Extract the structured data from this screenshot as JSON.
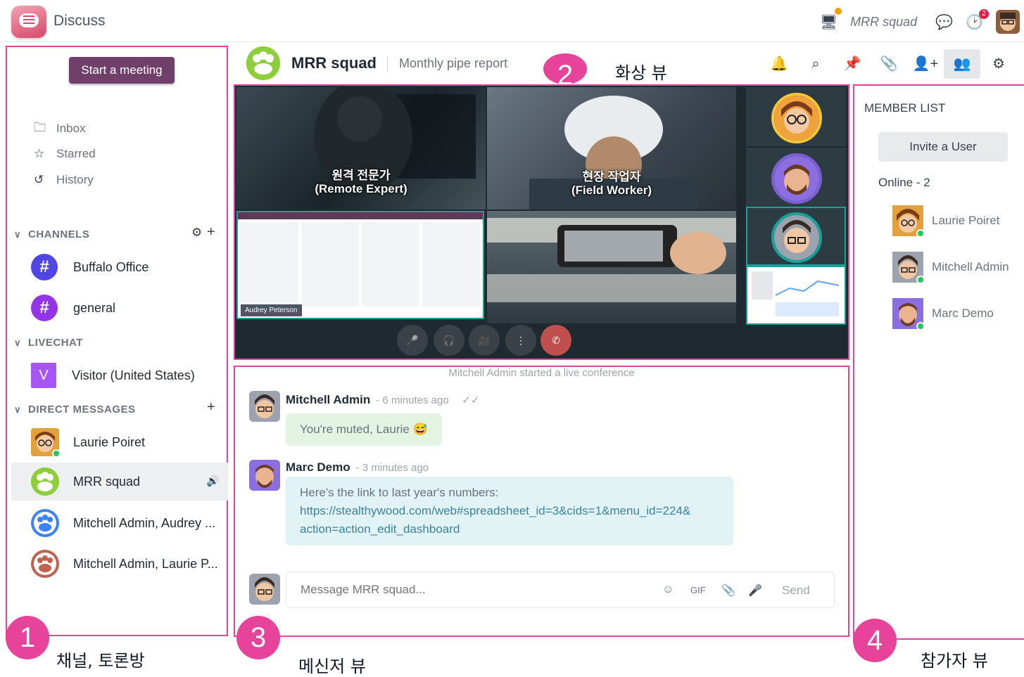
{
  "app": {
    "name": "Discuss"
  },
  "topbar": {
    "current_channel": "MRR squad",
    "activity_badge": "2"
  },
  "sidebar": {
    "start_meeting": "Start a meeting",
    "nav": [
      {
        "label": "Inbox",
        "icon": "inbox-icon"
      },
      {
        "label": "Starred",
        "icon": "star-icon"
      },
      {
        "label": "History",
        "icon": "history-icon"
      }
    ],
    "sections": {
      "channels": "CHANNELS",
      "livechat": "LIVECHAT",
      "direct_messages": "DIRECT MESSAGES"
    },
    "channels": [
      {
        "label": "Buffalo Office",
        "color": "#4f46e5"
      },
      {
        "label": "general",
        "color": "#9333ea"
      }
    ],
    "livechat": [
      {
        "label": "Visitor (United States)",
        "initial": "V"
      }
    ],
    "direct_messages": [
      {
        "label": "Laurie Poiret"
      },
      {
        "label": "MRR squad",
        "active": true
      },
      {
        "label": "Mitchell Admin, Audrey ..."
      },
      {
        "label": "Mitchell Admin, Laurie P..."
      }
    ]
  },
  "thread": {
    "title": "MRR squad",
    "description": "Monthly pipe report"
  },
  "video": {
    "tile1_text": "원격 전문가\n(Remote Expert)",
    "tile2_text": "현장 작업자\n(Field Worker)",
    "screen_share_name": "Audrey Peterson"
  },
  "messages": {
    "conference_note": "Mitchell Admin started a live conference",
    "items": [
      {
        "author": "Mitchell Admin",
        "time": "- 6 minutes ago",
        "body": "You're muted, Laurie 😅"
      },
      {
        "author": "Marc Demo",
        "time": "- 3 minutes ago",
        "body_line1": "Here's the link to last year's numbers:",
        "link": "https://stealthywood.com/web#spreadsheet_id=3&cids=1&menu_id=224&",
        "link2": "action=action_edit_dashboard"
      }
    ],
    "composer_placeholder": "Message MRR squad...",
    "gif_label": "GIF",
    "send_label": "Send"
  },
  "members": {
    "title": "MEMBER LIST",
    "invite": "Invite a User",
    "online_label": "Online - 2",
    "list": [
      {
        "name": "Laurie Poiret"
      },
      {
        "name": "Mitchell Admin"
      },
      {
        "name": "Marc Demo"
      }
    ]
  },
  "annotations": {
    "one": "1",
    "two": "2",
    "three": "3",
    "four": "4",
    "caption1": "채널, 토론방",
    "caption2": "화상 뷰",
    "caption3": "메신저 뷰",
    "caption4": "참가자 뷰"
  }
}
